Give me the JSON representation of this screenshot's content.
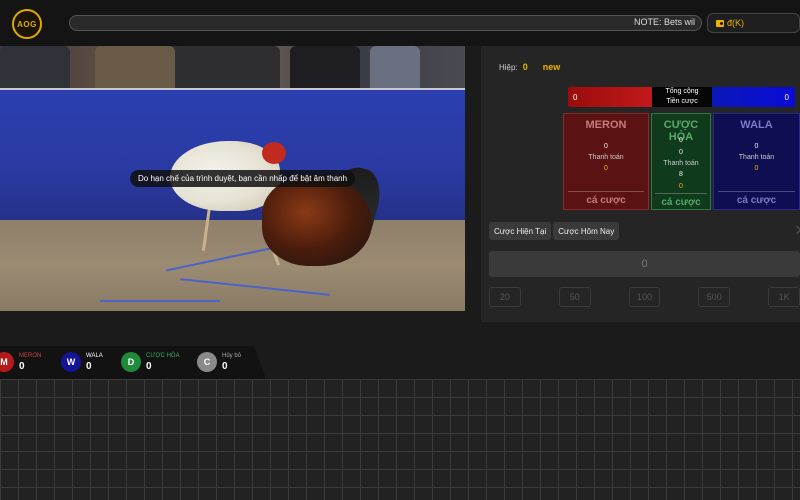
{
  "header": {
    "logo": "AOG",
    "marquee": "NOTE: Bets wil",
    "balance": "đ(K)"
  },
  "video": {
    "sound_notice": "Do hạn chế của trình duyệt, bạn cần nhấp để bật âm thanh"
  },
  "panel": {
    "round_label": "Hiệp:",
    "round_number": "0",
    "round_status": "new",
    "total_meron": "0",
    "total_label_1": "Tổng cộng",
    "total_label_2": "Tiền cược",
    "total_wala": "0",
    "cards": [
      {
        "title": "MERON",
        "value1": "0",
        "label": "Thanh toán",
        "value2": "0",
        "bet": "cá cược"
      },
      {
        "title": "CƯỢC HÒA",
        "value0": "0",
        "value1": "0",
        "label": "Thanh toán",
        "value2": "8",
        "value3": "0",
        "bet": "cá cược"
      },
      {
        "title": "WALA",
        "value1": "0",
        "label": "Thanh toán",
        "value2": "0",
        "bet": "cá cược"
      }
    ],
    "tabs": [
      "Cược Hiện Tại",
      "Cược Hôm Nay"
    ],
    "amount": "0",
    "chips": [
      "20",
      "50",
      "100",
      "500",
      "1K"
    ]
  },
  "stats": [
    {
      "letter": "M",
      "name": "MERON",
      "count": "0",
      "color": "#b51a1a",
      "name_color": "#d04040"
    },
    {
      "letter": "W",
      "name": "WALA",
      "count": "0",
      "color": "#141494",
      "name_color": "#ffffff"
    },
    {
      "letter": "D",
      "name": "CƯỢC HÒA",
      "count": "0",
      "color": "#1f8a3a",
      "name_color": "#3fae5a"
    },
    {
      "letter": "C",
      "name": "Hủy bỏ",
      "count": "0",
      "color": "#8a8a8a",
      "name_color": "#aaaaaa"
    }
  ]
}
